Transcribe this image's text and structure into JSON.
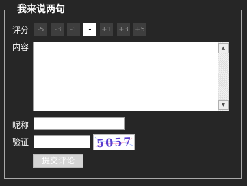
{
  "form": {
    "legend": "我来说两句",
    "rating_label": "评分",
    "rating_options": [
      "-5",
      "-3",
      "-1",
      "-",
      "+1",
      "+3",
      "+5"
    ],
    "rating_selected": "-",
    "content_label": "内容",
    "content_value": "",
    "nickname_label": "昵称",
    "nickname_value": "",
    "verify_label": "验证",
    "verify_value": "",
    "captcha_text": "5057",
    "submit_label": "提交评论"
  },
  "colors": {
    "background": "#262626",
    "rating_button": "#3e3e3e",
    "rating_selected": "#ffffff",
    "submit_button": "#d4d4d4"
  }
}
